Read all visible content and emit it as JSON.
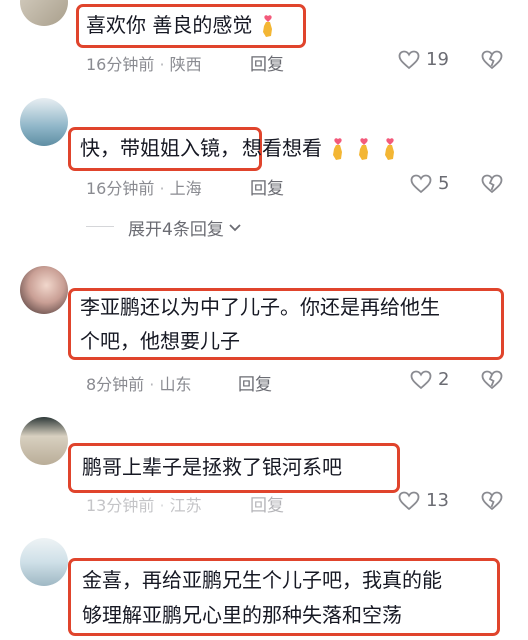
{
  "comments": [
    {
      "text": "喜欢你 善良的感觉",
      "time": "16分钟前",
      "location": "陕西",
      "reply": "回复",
      "likes": "19"
    },
    {
      "text_highlight": "快，带姐姐入镜，",
      "text_rest": "想看想看",
      "time": "16分钟前",
      "location": "上海",
      "reply": "回复",
      "likes": "5",
      "expand": "展开4条回复"
    },
    {
      "line1": "李亚鹏还以为中了儿子。你还是再给他生",
      "line2": "个吧，他想要儿子",
      "time": "8分钟前",
      "location": "山东",
      "reply": "回复",
      "likes": "2"
    },
    {
      "text": "鹏哥上辈子是拯救了银河系吧",
      "time": "13分钟前",
      "location": "江苏",
      "reply": "回复",
      "likes": "13"
    },
    {
      "line1": "金喜，再给亚鹏兄生个儿子吧，我真的能",
      "line2": "够理解亚鹏兄心里的那种失落和空荡"
    }
  ],
  "colors": {
    "highlight": "#e0442c",
    "meta": "#8a8b91"
  },
  "icons": [
    "heart-icon",
    "broken-heart-icon",
    "finger-heart-emoji",
    "chevron-down-icon"
  ]
}
